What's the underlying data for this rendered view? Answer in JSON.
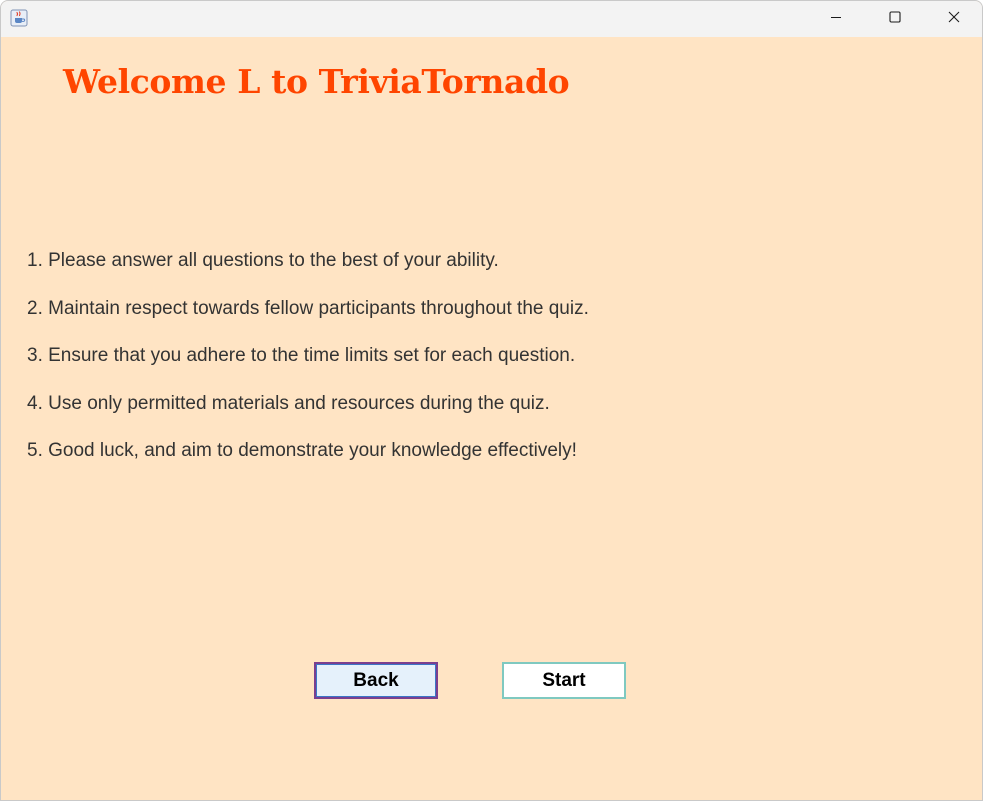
{
  "window": {
    "icon": "java-coffee-cup-icon",
    "controls": {
      "minimize_icon": "minimize-icon",
      "maximize_icon": "maximize-icon",
      "close_icon": "close-icon"
    }
  },
  "page": {
    "title": "Welcome L to TriviaTornado",
    "title_color": "#ff4500",
    "background_color": "#ffe4c4",
    "rules": [
      "1. Please answer all questions to the best of your ability.",
      "2. Maintain respect towards fellow participants throughout the quiz.",
      "3. Ensure that you adhere to the time limits set for each question.",
      "4. Use only permitted materials and resources during the quiz.",
      "5. Good luck, and aim to demonstrate your knowledge effectively!"
    ],
    "buttons": {
      "back_label": "Back",
      "start_label": "Start"
    }
  }
}
